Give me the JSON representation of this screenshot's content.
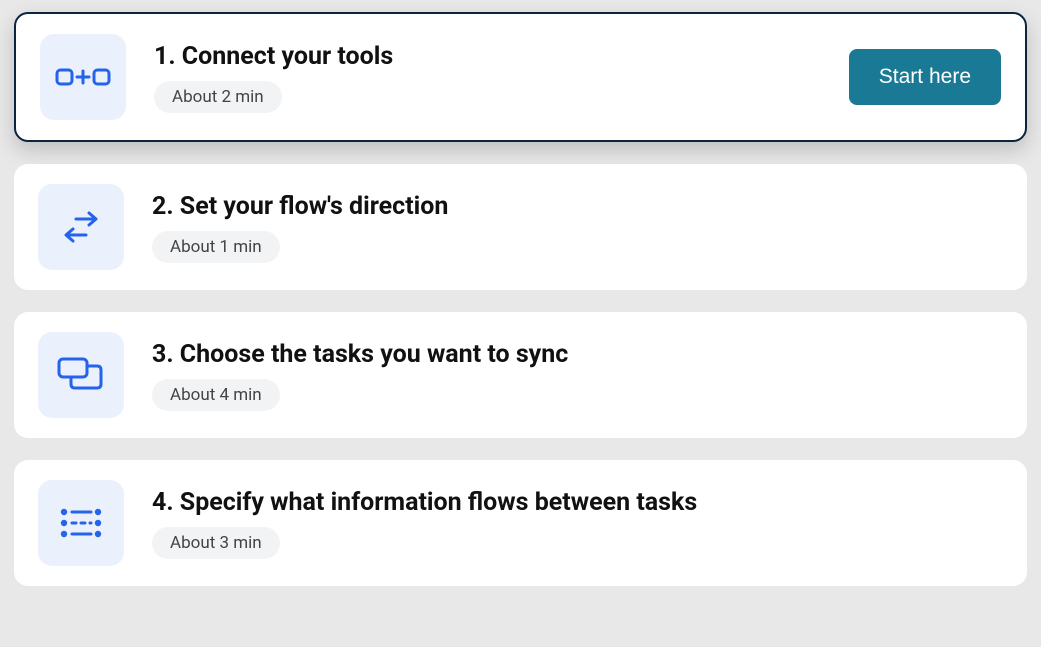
{
  "steps": [
    {
      "title": "1. Connect your tools",
      "time": "About 2 min",
      "active": true,
      "button": "Start here",
      "icon": "connect-icon"
    },
    {
      "title": "2. Set your flow's direction",
      "time": "About 1 min",
      "active": false,
      "icon": "direction-icon"
    },
    {
      "title": "3. Choose the tasks you want to sync",
      "time": "About 4 min",
      "active": false,
      "icon": "tasks-icon"
    },
    {
      "title": "4. Specify what information flows between tasks",
      "time": "About 3 min",
      "active": false,
      "icon": "flow-list-icon"
    }
  ]
}
